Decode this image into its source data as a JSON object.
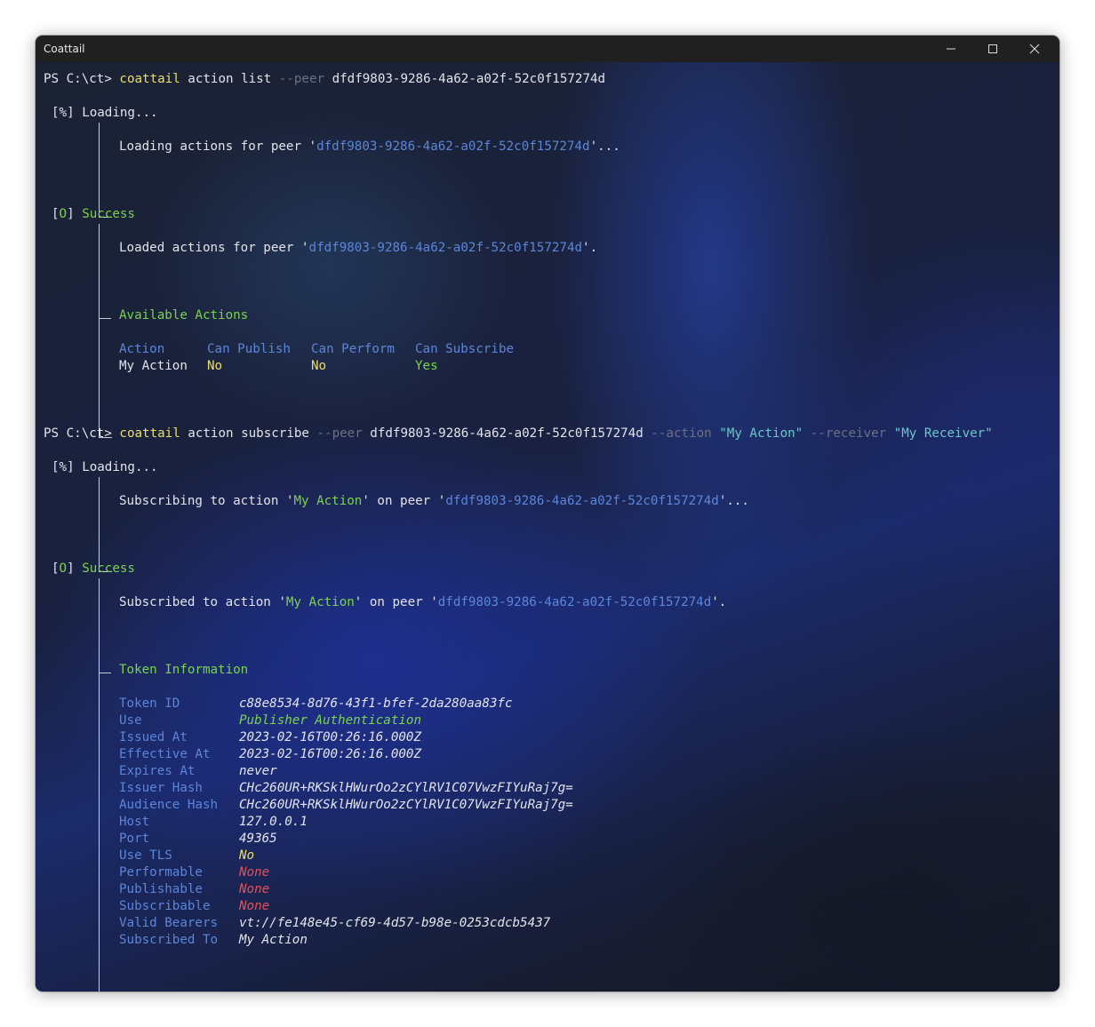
{
  "window": {
    "title": "Coattail"
  },
  "cmd1": {
    "prompt": "PS C:\\ct> ",
    "program": "coattail",
    "args": " action list ",
    "flag_peer": "--peer",
    "peer_id": " dfdf9803-9286-4a62-a02f-52c0f157274d"
  },
  "block1": {
    "tag_open": "[",
    "tag_sym": "%",
    "tag_close": "]",
    "status": "Loading...",
    "msg_pre": "Loading actions for peer '",
    "peer_id": "dfdf9803-9286-4a62-a02f-52c0f157274d",
    "msg_post": "'..."
  },
  "block2": {
    "tag_open": "[",
    "tag_sym": "O",
    "tag_close": "]",
    "status": "Success",
    "msg_pre": "Loaded actions for peer '",
    "peer_id": "dfdf9803-9286-4a62-a02f-52c0f157274d",
    "msg_post": "'.",
    "section_title": "Available Actions",
    "table": {
      "headers": [
        "Action",
        "Can Publish",
        "Can Perform",
        "Can Subscribe"
      ],
      "rows": [
        [
          "My Action",
          "No",
          "No",
          "Yes"
        ]
      ]
    }
  },
  "cmd2": {
    "prompt": "PS C:\\ct> ",
    "program": "coattail",
    "args": " action subscribe ",
    "flag_peer": "--peer",
    "peer_id": " dfdf9803-9286-4a62-a02f-52c0f157274d ",
    "flag_action": "--action",
    "action_val": " \"My Action\" ",
    "flag_receiver": "--receiver",
    "receiver_val": " \"My Receiver\""
  },
  "block3": {
    "tag_open": "[",
    "tag_sym": "%",
    "tag_close": "]",
    "status": "Loading...",
    "msg_pre": "Subscribing to action '",
    "action": "My Action",
    "msg_mid": "' on peer '",
    "peer_id": "dfdf9803-9286-4a62-a02f-52c0f157274d",
    "msg_post": "'..."
  },
  "block4": {
    "tag_open": "[",
    "tag_sym": "O",
    "tag_close": "]",
    "status": "Success",
    "msg_pre": "Subscribed to action '",
    "action": "My Action",
    "msg_mid": "' on peer '",
    "peer_id": "dfdf9803-9286-4a62-a02f-52c0f157274d",
    "msg_post": "'.",
    "section_title": "Token Information",
    "token": [
      {
        "key": "Token ID",
        "value": "c88e8534-8d76-43f1-bfef-2da280aa83fc",
        "color": "#e2e4ea"
      },
      {
        "key": "Use",
        "value": "Publisher Authentication",
        "color": "#7bd24f"
      },
      {
        "key": "Issued At",
        "value": "2023-02-16T00:26:16.000Z",
        "color": "#e2e4ea"
      },
      {
        "key": "Effective At",
        "value": "2023-02-16T00:26:16.000Z",
        "color": "#e2e4ea"
      },
      {
        "key": "Expires At",
        "value": "never",
        "color": "#e2e4ea"
      },
      {
        "key": "Issuer Hash",
        "value": "CHc260UR+RKSklHWurOo2zCYlRV1C07VwzFIYuRaj7g=",
        "color": "#e2e4ea"
      },
      {
        "key": "Audience Hash",
        "value": "CHc260UR+RKSklHWurOo2zCYlRV1C07VwzFIYuRaj7g=",
        "color": "#e2e4ea"
      },
      {
        "key": "Host",
        "value": "127.0.0.1",
        "color": "#e2e4ea"
      },
      {
        "key": "Port",
        "value": "49365",
        "color": "#e2e4ea"
      },
      {
        "key": "Use TLS",
        "value": "No",
        "color": "#eadf68"
      },
      {
        "key": "Performable",
        "value": "None",
        "color": "#e0525c"
      },
      {
        "key": "Publishable",
        "value": "None",
        "color": "#e0525c"
      },
      {
        "key": "Subscribable",
        "value": "None",
        "color": "#e0525c"
      },
      {
        "key": "Valid Bearers",
        "value": "vt://fe148e45-cf69-4d57-b98e-0253cdcb5437",
        "color": "#e2e4ea"
      },
      {
        "key": "Subscribed To",
        "value": "My Action",
        "color": "#e2e4ea"
      }
    ]
  },
  "colors": {
    "program": "#eadf68",
    "flag": "#6b7183",
    "peer_id": "#5b86d9",
    "string_arg": "#6ac7c9",
    "success": "#7bd24f",
    "key": "#5b86d9",
    "no": "#eadf68",
    "yes": "#7bd24f",
    "none": "#e0525c"
  }
}
